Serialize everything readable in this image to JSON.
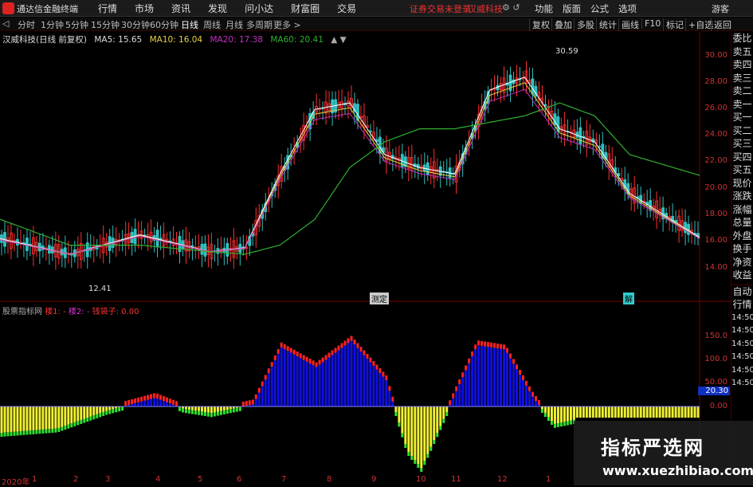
{
  "app": {
    "title": "通达信金融终端"
  },
  "menu": [
    "行情",
    "市场",
    "资讯",
    "发现",
    "问小达",
    "财富圈",
    "交易"
  ],
  "warning": "证券交易未登录",
  "stock_name_top": "汉威科技",
  "right_menu": [
    "功能",
    "版面",
    "公式",
    "选项"
  ],
  "guest": "游客",
  "periods": [
    "分时",
    "1分钟",
    "5分钟",
    "15分钟",
    "30分钟",
    "60分钟",
    "日线",
    "周线",
    "月线",
    "多周期",
    "更多 >"
  ],
  "active_period": "日线",
  "tools": [
    "复权",
    "叠加",
    "多股",
    "统计",
    "画线",
    "F10",
    "标记",
    "+自选",
    "返回"
  ],
  "legend": {
    "title": "汉威科技(日线 前复权)",
    "ma5": "MA5: 15.65",
    "ma10": "MA10: 16.04",
    "ma20": "MA20: 17.38",
    "ma60": "MA60: 20.41"
  },
  "price_axis": [
    "30.00",
    "28.00",
    "26.00",
    "24.00",
    "22.00",
    "20.00",
    "18.00",
    "16.00",
    "14.00"
  ],
  "price_high": "30.59",
  "price_low": "12.41",
  "markers": {
    "m1": "测定",
    "m2": "解"
  },
  "indicator": {
    "name": "股票指标网",
    "t1": "楼1: -",
    "t2": "楼2: -",
    "t3": "钱袋子: 0.00"
  },
  "ind_axis": [
    "150.0",
    "100.0",
    "50.00",
    "0.00"
  ],
  "ind_value": "20.30",
  "sidebar": [
    "委比",
    "卖五",
    "卖四",
    "卖三",
    "卖二",
    "卖一",
    "买一",
    "买二",
    "买三",
    "买四",
    "买五",
    "现价",
    "涨跌",
    "涨幅",
    "总量",
    "外盘",
    "换手",
    "净资",
    "收益",
    "",
    "自动",
    "行情",
    "14:50",
    "14:50",
    "14:50",
    "14:50",
    "14:50",
    "14:50",
    "14:50",
    "14:50"
  ],
  "xaxis": [
    "2020年",
    "1",
    "2",
    "3",
    "4",
    "5",
    "6",
    "7",
    "8",
    "9",
    "10",
    "11",
    "12",
    "1"
  ],
  "watermark": {
    "cn": "指标严选网",
    "url": "www.xuezhibiao.com"
  },
  "colors": {
    "ma5": "#ffffff",
    "ma10": "#e8d040",
    "ma20": "#c030c0",
    "ma60": "#30b030",
    "up": "#ff3030",
    "down": "#30c0c0"
  },
  "chart_data": {
    "type": "line",
    "x": [
      0,
      0.1,
      0.2,
      0.3,
      0.35,
      0.4,
      0.45,
      0.5,
      0.55,
      0.6,
      0.65,
      0.7,
      0.75,
      0.8,
      0.85,
      0.9,
      1.0
    ],
    "series": [
      {
        "name": "MA5",
        "values": [
          15.5,
          14.3,
          15.8,
          14.5,
          14.8,
          20.5,
          25.5,
          26,
          22,
          21,
          20.5,
          27,
          28,
          24,
          23,
          19,
          15.6
        ]
      },
      {
        "name": "MA60",
        "values": [
          17,
          15,
          15,
          14.5,
          14.3,
          15,
          17,
          21,
          23,
          24,
          24,
          24.5,
          25,
          26,
          25,
          22,
          20.4
        ]
      }
    ],
    "ylim": [
      13,
      31
    ]
  }
}
